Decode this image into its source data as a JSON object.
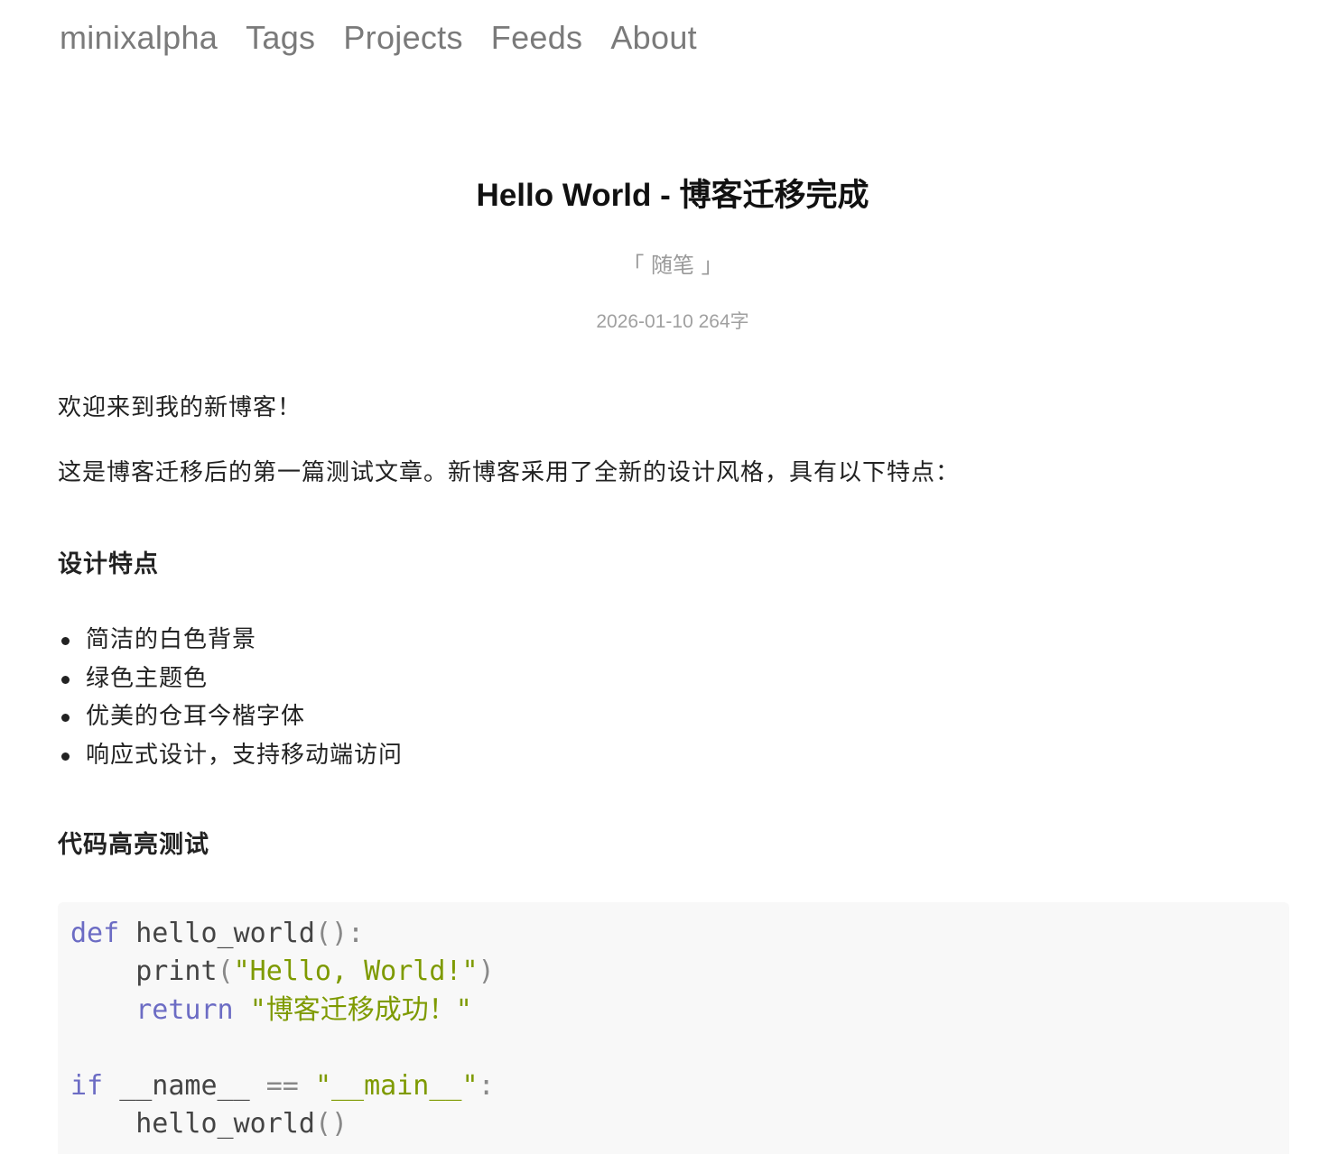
{
  "nav": {
    "brand": "minixalpha",
    "links": [
      "Tags",
      "Projects",
      "Feeds",
      "About"
    ]
  },
  "post": {
    "title": "Hello World - 博客迁移完成",
    "category": "「 随笔 」",
    "date": "2026-01-10",
    "word_count": "264字",
    "paragraphs": [
      "欢迎来到我的新博客！",
      "这是博客迁移后的第一篇测试文章。新博客采用了全新的设计风格，具有以下特点："
    ],
    "section1_title": "设计特点",
    "features": [
      "简洁的白色背景",
      "绿色主题色",
      "优美的仓耳今楷字体",
      "响应式设计，支持移动端访问"
    ],
    "section2_title": "代码高亮测试",
    "code": {
      "language": "python",
      "kw_def": "def",
      "fn_name": "hello_world",
      "punc_call": "():",
      "print_name": "print",
      "punc_open": "(",
      "str_hello": "\"Hello, World!\"",
      "punc_close": ")",
      "kw_return": "return",
      "str_success": "\"博客迁移成功！\"",
      "kw_if": "if",
      "dunder_name": "__name__",
      "op_eq": "==",
      "str_main": "\"__main__\"",
      "punc_colon": ":",
      "call_name": "hello_world",
      "punc_empty_call": "()"
    }
  },
  "colors": {
    "nav_text": "#7a7a7a",
    "code_keyword": "#6c6cc4",
    "code_string": "#7e9a00",
    "code_background": "#f8f8f8"
  }
}
